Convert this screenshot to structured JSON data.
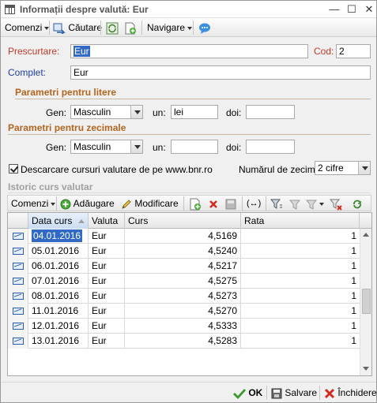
{
  "window": {
    "title": "Informații despre valută: Eur",
    "controls": {
      "minimize": "—",
      "maximize": "☐",
      "close": "✕"
    }
  },
  "toolbar": {
    "commands_label": "Comenzi",
    "search_label": "Căutare",
    "navigate_label": "Navigare"
  },
  "form": {
    "prescurtare_label": "Prescurtare:",
    "prescurtare_value": "Eur",
    "cod_label": "Cod:",
    "cod_value": "2",
    "complet_label": "Complet:",
    "complet_value": "Eur",
    "letters_section": "Parametri pentru litere",
    "decimals_section": "Parametri pentru zecimale",
    "gen_label": "Gen:",
    "un_label": "un:",
    "doi_label": "doi:",
    "letters_gen": "Masculin",
    "letters_un": "lei",
    "letters_doi": "",
    "decimals_gen": "Masculin",
    "decimals_un": "",
    "decimals_doi": "",
    "bnr_checkbox_label": "Descarcare cursuri valutare de pe www.bnr.ro",
    "bnr_checked": true,
    "decimals_count_label": "Numărul de zecim...",
    "decimals_count_value": "2 cifre"
  },
  "history": {
    "title": "Istoric curs valutar",
    "commands_label": "Comenzi",
    "add_label": "Adăugare",
    "edit_label": "Modificare",
    "link_label": "(↔)",
    "columns": [
      "Data curs",
      "Valuta",
      "Curs",
      "Rata"
    ],
    "rows": [
      {
        "date": "04.01.2016",
        "currency": "Eur",
        "rate": "4,5169",
        "ratio": "1"
      },
      {
        "date": "05.01.2016",
        "currency": "Eur",
        "rate": "4,5240",
        "ratio": "1"
      },
      {
        "date": "06.01.2016",
        "currency": "Eur",
        "rate": "4,5217",
        "ratio": "1"
      },
      {
        "date": "07.01.2016",
        "currency": "Eur",
        "rate": "4,5275",
        "ratio": "1"
      },
      {
        "date": "08.01.2016",
        "currency": "Eur",
        "rate": "4,5273",
        "ratio": "1"
      },
      {
        "date": "11.01.2016",
        "currency": "Eur",
        "rate": "4,5270",
        "ratio": "1"
      },
      {
        "date": "12.01.2016",
        "currency": "Eur",
        "rate": "4,5333",
        "ratio": "1"
      },
      {
        "date": "13.01.2016",
        "currency": "Eur",
        "rate": "4,5283",
        "ratio": "1"
      }
    ]
  },
  "footer": {
    "ok_label": "OK",
    "save_label": "Salvare",
    "close_label": "Închidere"
  },
  "colors": {
    "required_label": "#c0392b",
    "section_title": "#b5651d",
    "selection": "#316ac5",
    "ok_green": "#3a9a2a",
    "close_red": "#d62a1e"
  }
}
